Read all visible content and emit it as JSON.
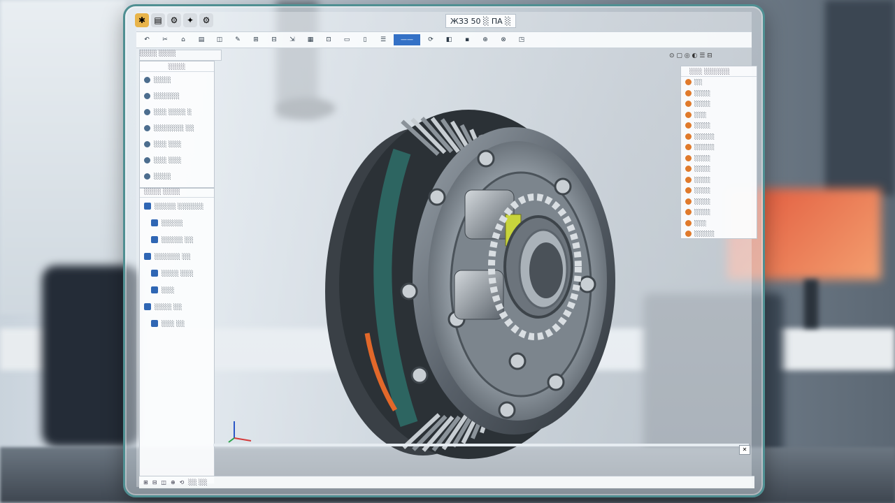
{
  "window": {
    "title": "ЖЗЗ 50 ░ ПА ░",
    "app_icons": [
      "app-icon",
      "file-icon",
      "gear-icon",
      "wrench-icon",
      "settings-icon"
    ]
  },
  "toolbar": {
    "items": [
      "↶",
      "✂",
      "⌂",
      "▤",
      "◫",
      "✎",
      "⊞",
      "⊟",
      "⇲",
      "▦",
      "⊡",
      "▭",
      "▯",
      "☰",
      "⟳",
      "◧",
      "▪",
      "⊕",
      "⊗",
      "◳"
    ],
    "active_label": "——"
  },
  "left_panel": {
    "header": "░░░░ ░░░░",
    "tree_header": "░░░░",
    "tree_items": [
      "░░░░",
      "░░░░░░",
      "░░░ ░░░░ ░",
      "░░░░░░░ ░░",
      "░░░ ░░░",
      "░░░ ░░░",
      "░░░░"
    ],
    "section_header": "░░░░ ░░░░",
    "features": [
      "░░░░░ ░░░░░░",
      "░░░░░",
      "░░░░░ ░░",
      "░░░░░░ ░░",
      "░░░░ ░░░",
      "░░░",
      "░░░░ ░░",
      "░░░ ░░"
    ]
  },
  "right_panel": {
    "header": "░░░ ░░░░░░",
    "items": [
      "░░",
      "░░░░",
      "░░░░",
      "░░░",
      "░░░░",
      "░░░░░",
      "░░░░░",
      "░░░░",
      "░░░░",
      "░░░░",
      "░░░░",
      "░░░░",
      "░░░░",
      "░░░",
      "░░░░░"
    ]
  },
  "status_bar": {
    "items": [
      "⊞",
      "⊟",
      "◫",
      "⊕",
      "⟲",
      "░░ ░░"
    ]
  },
  "colors": {
    "frame": "#4f8f92",
    "accent": "#3471c6",
    "tree_icon": "#2f66b4",
    "component_icon": "#e07a2c"
  }
}
